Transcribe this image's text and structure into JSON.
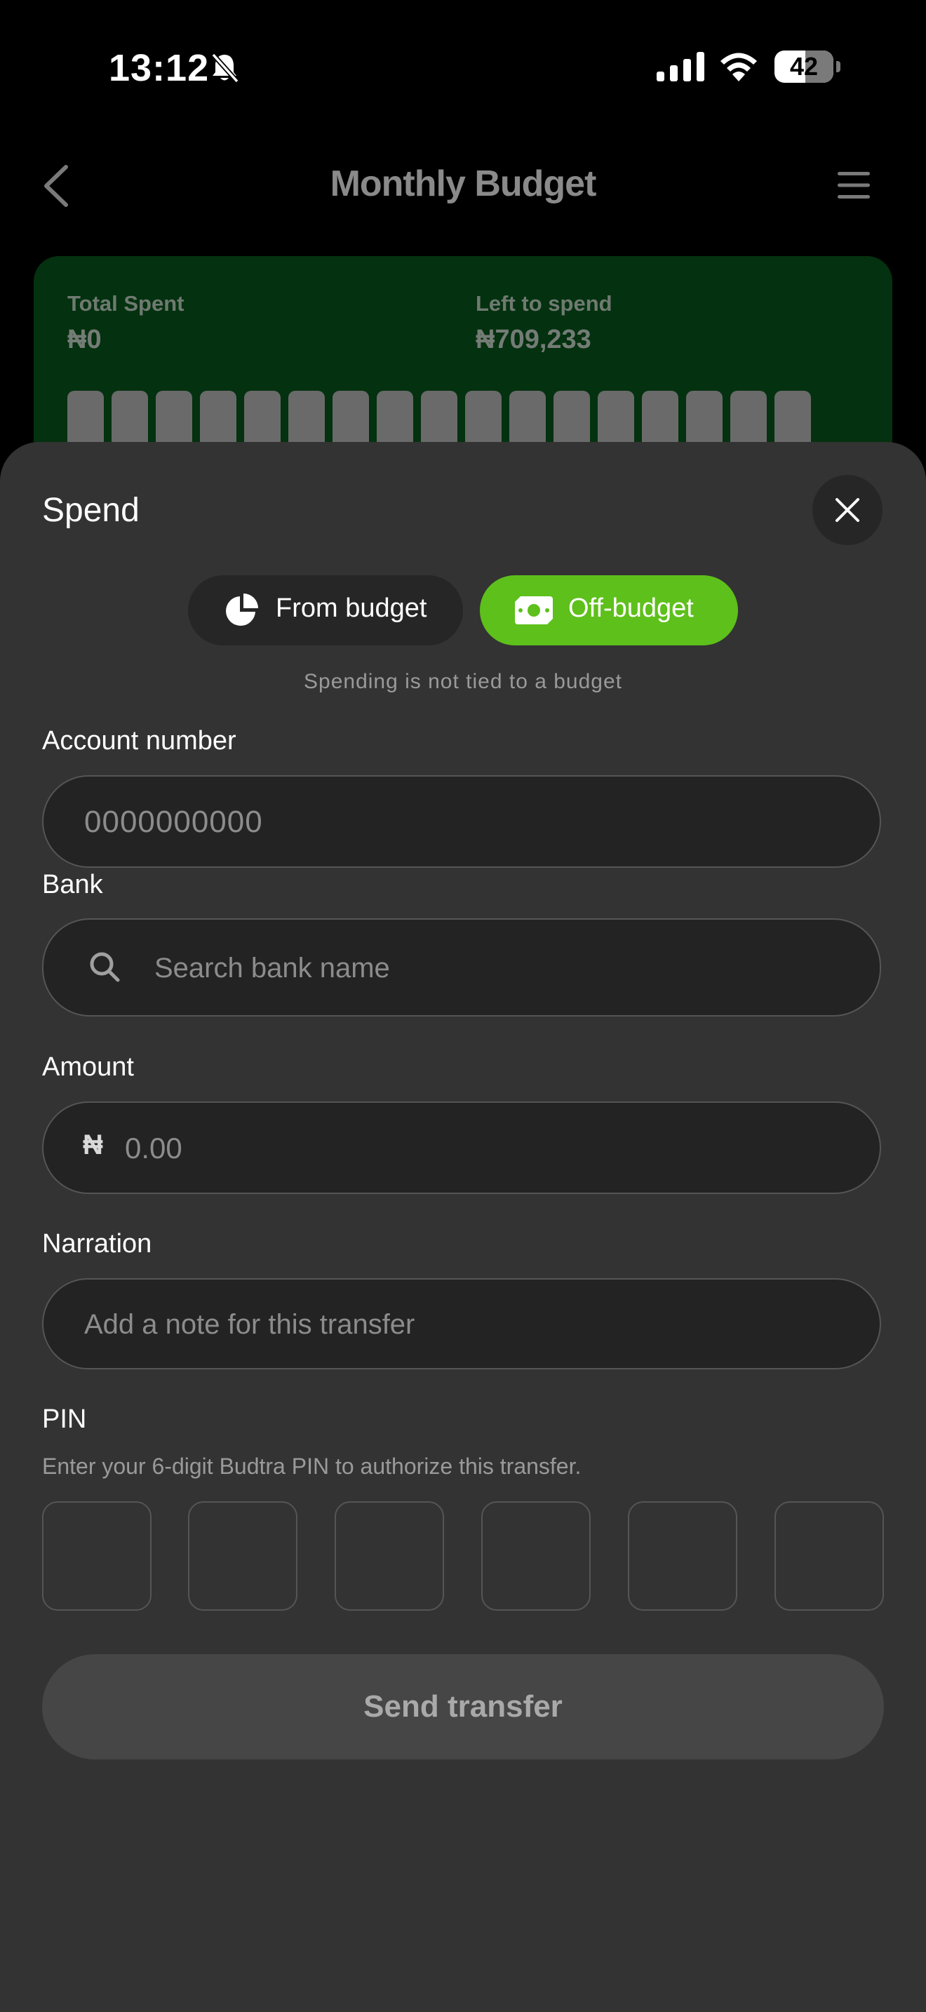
{
  "status_bar": {
    "time": "13:12",
    "battery_level": "42",
    "icons": [
      "bell-slash-icon",
      "cellular-signal-icon",
      "wifi-icon",
      "battery-icon"
    ]
  },
  "header": {
    "title": "Monthly Budget",
    "icons": [
      "chevron-left-icon",
      "hamburger-menu-icon"
    ]
  },
  "budget_card": {
    "total_spent_label": "Total Spent",
    "total_spent_value": "₦0",
    "left_label": "Left to spend",
    "left_value": "₦709,233"
  },
  "sheet": {
    "title": "Spend",
    "close_icon": "close-icon",
    "toggle": {
      "from_budget_label": "From budget",
      "off_budget_label": "Off-budget",
      "selected": "Off-budget"
    },
    "helper_text": "Spending is not tied to a budget",
    "account": {
      "label": "Account number",
      "placeholder": "0000000000",
      "value": ""
    },
    "bank": {
      "label": "Bank",
      "placeholder": "Search bank name",
      "value": ""
    },
    "amount": {
      "label": "Amount",
      "currency": "₦",
      "placeholder": "0.00",
      "value": ""
    },
    "narration": {
      "label": "Narration",
      "placeholder": "Add a note for this transfer",
      "value": ""
    },
    "pin": {
      "label": "PIN",
      "help": "Enter your 6-digit Budtra PIN to authorize this transfer."
    },
    "send_label": "Send transfer"
  },
  "colors": {
    "accent_green": "#5ec01b",
    "card_green": "#04310f",
    "sheet_bg": "#333333"
  }
}
